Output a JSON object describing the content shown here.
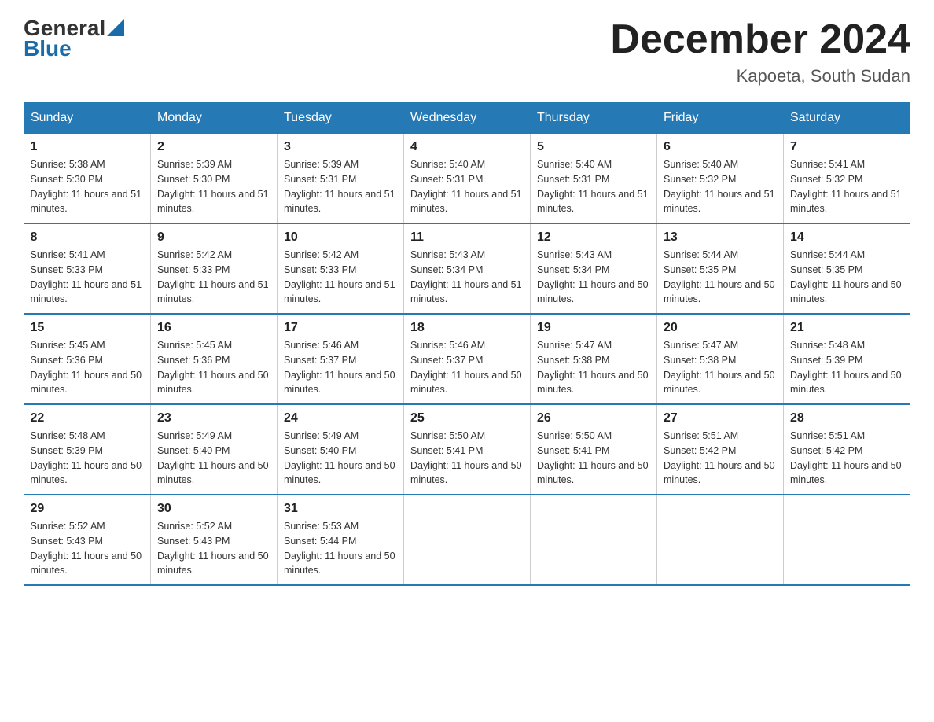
{
  "header": {
    "logo_general": "General",
    "logo_blue": "Blue",
    "month_title": "December 2024",
    "location": "Kapoeta, South Sudan"
  },
  "days_of_week": [
    "Sunday",
    "Monday",
    "Tuesday",
    "Wednesday",
    "Thursday",
    "Friday",
    "Saturday"
  ],
  "weeks": [
    [
      {
        "day": "1",
        "sunrise": "5:38 AM",
        "sunset": "5:30 PM",
        "daylight": "11 hours and 51 minutes."
      },
      {
        "day": "2",
        "sunrise": "5:39 AM",
        "sunset": "5:30 PM",
        "daylight": "11 hours and 51 minutes."
      },
      {
        "day": "3",
        "sunrise": "5:39 AM",
        "sunset": "5:31 PM",
        "daylight": "11 hours and 51 minutes."
      },
      {
        "day": "4",
        "sunrise": "5:40 AM",
        "sunset": "5:31 PM",
        "daylight": "11 hours and 51 minutes."
      },
      {
        "day": "5",
        "sunrise": "5:40 AM",
        "sunset": "5:31 PM",
        "daylight": "11 hours and 51 minutes."
      },
      {
        "day": "6",
        "sunrise": "5:40 AM",
        "sunset": "5:32 PM",
        "daylight": "11 hours and 51 minutes."
      },
      {
        "day": "7",
        "sunrise": "5:41 AM",
        "sunset": "5:32 PM",
        "daylight": "11 hours and 51 minutes."
      }
    ],
    [
      {
        "day": "8",
        "sunrise": "5:41 AM",
        "sunset": "5:33 PM",
        "daylight": "11 hours and 51 minutes."
      },
      {
        "day": "9",
        "sunrise": "5:42 AM",
        "sunset": "5:33 PM",
        "daylight": "11 hours and 51 minutes."
      },
      {
        "day": "10",
        "sunrise": "5:42 AM",
        "sunset": "5:33 PM",
        "daylight": "11 hours and 51 minutes."
      },
      {
        "day": "11",
        "sunrise": "5:43 AM",
        "sunset": "5:34 PM",
        "daylight": "11 hours and 51 minutes."
      },
      {
        "day": "12",
        "sunrise": "5:43 AM",
        "sunset": "5:34 PM",
        "daylight": "11 hours and 50 minutes."
      },
      {
        "day": "13",
        "sunrise": "5:44 AM",
        "sunset": "5:35 PM",
        "daylight": "11 hours and 50 minutes."
      },
      {
        "day": "14",
        "sunrise": "5:44 AM",
        "sunset": "5:35 PM",
        "daylight": "11 hours and 50 minutes."
      }
    ],
    [
      {
        "day": "15",
        "sunrise": "5:45 AM",
        "sunset": "5:36 PM",
        "daylight": "11 hours and 50 minutes."
      },
      {
        "day": "16",
        "sunrise": "5:45 AM",
        "sunset": "5:36 PM",
        "daylight": "11 hours and 50 minutes."
      },
      {
        "day": "17",
        "sunrise": "5:46 AM",
        "sunset": "5:37 PM",
        "daylight": "11 hours and 50 minutes."
      },
      {
        "day": "18",
        "sunrise": "5:46 AM",
        "sunset": "5:37 PM",
        "daylight": "11 hours and 50 minutes."
      },
      {
        "day": "19",
        "sunrise": "5:47 AM",
        "sunset": "5:38 PM",
        "daylight": "11 hours and 50 minutes."
      },
      {
        "day": "20",
        "sunrise": "5:47 AM",
        "sunset": "5:38 PM",
        "daylight": "11 hours and 50 minutes."
      },
      {
        "day": "21",
        "sunrise": "5:48 AM",
        "sunset": "5:39 PM",
        "daylight": "11 hours and 50 minutes."
      }
    ],
    [
      {
        "day": "22",
        "sunrise": "5:48 AM",
        "sunset": "5:39 PM",
        "daylight": "11 hours and 50 minutes."
      },
      {
        "day": "23",
        "sunrise": "5:49 AM",
        "sunset": "5:40 PM",
        "daylight": "11 hours and 50 minutes."
      },
      {
        "day": "24",
        "sunrise": "5:49 AM",
        "sunset": "5:40 PM",
        "daylight": "11 hours and 50 minutes."
      },
      {
        "day": "25",
        "sunrise": "5:50 AM",
        "sunset": "5:41 PM",
        "daylight": "11 hours and 50 minutes."
      },
      {
        "day": "26",
        "sunrise": "5:50 AM",
        "sunset": "5:41 PM",
        "daylight": "11 hours and 50 minutes."
      },
      {
        "day": "27",
        "sunrise": "5:51 AM",
        "sunset": "5:42 PM",
        "daylight": "11 hours and 50 minutes."
      },
      {
        "day": "28",
        "sunrise": "5:51 AM",
        "sunset": "5:42 PM",
        "daylight": "11 hours and 50 minutes."
      }
    ],
    [
      {
        "day": "29",
        "sunrise": "5:52 AM",
        "sunset": "5:43 PM",
        "daylight": "11 hours and 50 minutes."
      },
      {
        "day": "30",
        "sunrise": "5:52 AM",
        "sunset": "5:43 PM",
        "daylight": "11 hours and 50 minutes."
      },
      {
        "day": "31",
        "sunrise": "5:53 AM",
        "sunset": "5:44 PM",
        "daylight": "11 hours and 50 minutes."
      },
      null,
      null,
      null,
      null
    ]
  ]
}
